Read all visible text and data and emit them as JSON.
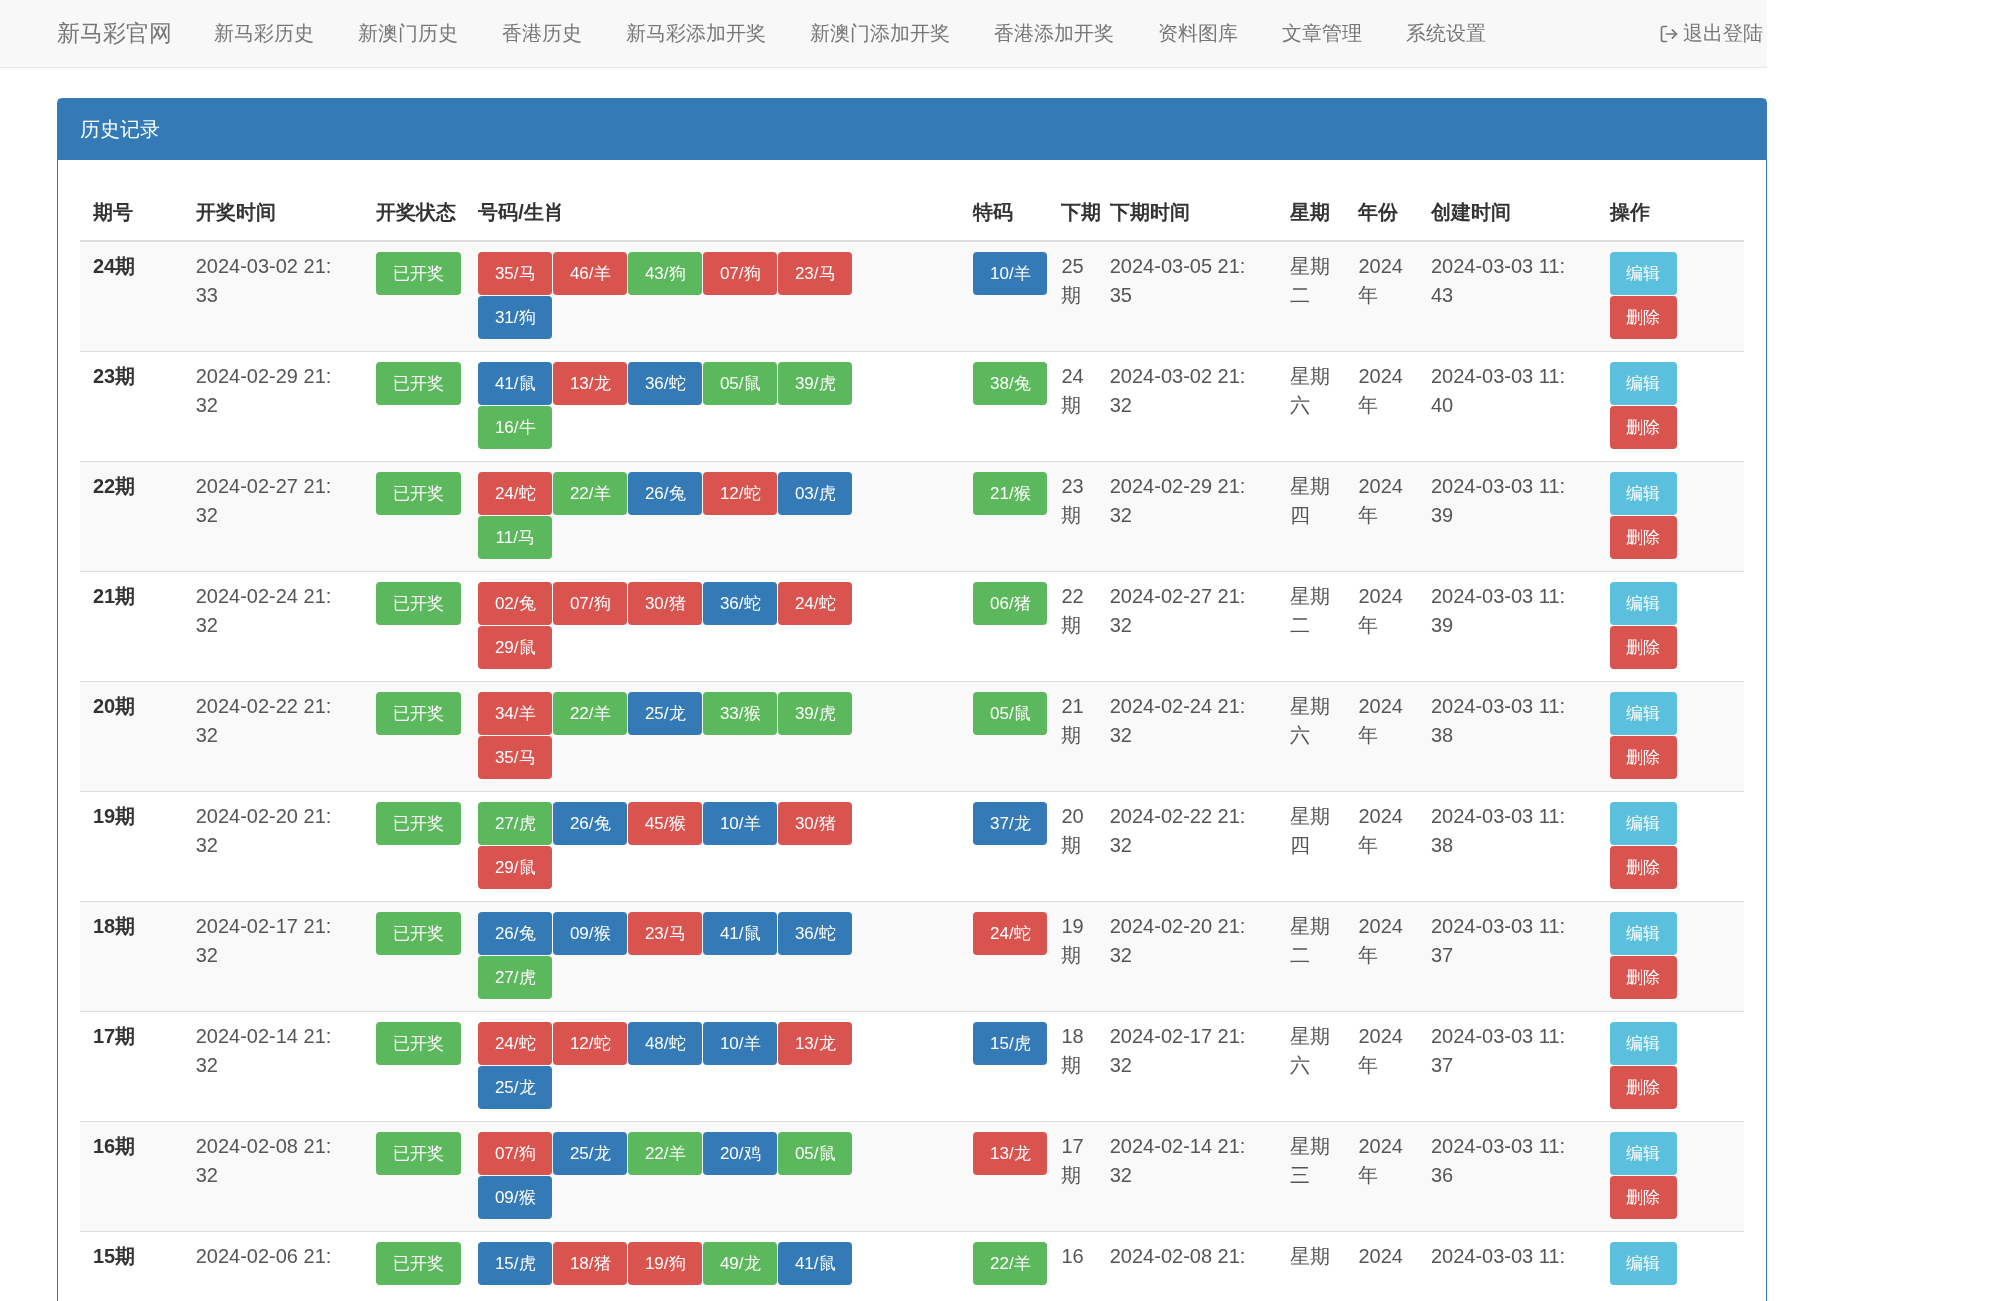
{
  "navbar": {
    "brand": "新马彩官网",
    "items": [
      "新马彩历史",
      "新澳门历史",
      "香港历史",
      "新马彩添加开奖",
      "新澳门添加开奖",
      "香港添加开奖",
      "资料图库",
      "文章管理",
      "系统设置"
    ],
    "logout": "退出登陆"
  },
  "panel": {
    "title": "历史记录",
    "columns": [
      "期号",
      "开奖时间",
      "开奖状态",
      "号码/生肖",
      "特码",
      "下期",
      "下期时间",
      "星期",
      "年份",
      "创建时间",
      "操作"
    ],
    "rows": [
      {
        "period": "24期",
        "draw_time": "2024-03-02 21:33",
        "status": "已开奖",
        "numbers": [
          {
            "text": "35/马",
            "color": "#d9534f"
          },
          {
            "text": "46/羊",
            "color": "#d9534f"
          },
          {
            "text": "43/狗",
            "color": "#5cb85c"
          },
          {
            "text": "07/狗",
            "color": "#d9534f"
          },
          {
            "text": "23/马",
            "color": "#d9534f"
          },
          {
            "text": "31/狗",
            "color": "#337ab7"
          }
        ],
        "special": {
          "text": "10/羊",
          "color": "#337ab7"
        },
        "next_period": "25期",
        "next_time": "2024-03-05 21:35",
        "weekday": "星期二",
        "year": "2024年",
        "created": "2024-03-03 11:43",
        "actions": [
          {
            "kind": "edit",
            "label": "编辑"
          },
          {
            "kind": "delete",
            "label": "删除"
          }
        ]
      },
      {
        "period": "23期",
        "draw_time": "2024-02-29 21:32",
        "status": "已开奖",
        "numbers": [
          {
            "text": "41/鼠",
            "color": "#337ab7"
          },
          {
            "text": "13/龙",
            "color": "#d9534f"
          },
          {
            "text": "36/蛇",
            "color": "#337ab7"
          },
          {
            "text": "05/鼠",
            "color": "#5cb85c"
          },
          {
            "text": "39/虎",
            "color": "#5cb85c"
          },
          {
            "text": "16/牛",
            "color": "#5cb85c"
          }
        ],
        "special": {
          "text": "38/兔",
          "color": "#5cb85c"
        },
        "next_period": "24期",
        "next_time": "2024-03-02 21:32",
        "weekday": "星期六",
        "year": "2024年",
        "created": "2024-03-03 11:40",
        "actions": [
          {
            "kind": "edit",
            "label": "编辑"
          },
          {
            "kind": "delete",
            "label": "删除"
          }
        ]
      },
      {
        "period": "22期",
        "draw_time": "2024-02-27 21:32",
        "status": "已开奖",
        "numbers": [
          {
            "text": "24/蛇",
            "color": "#d9534f"
          },
          {
            "text": "22/羊",
            "color": "#5cb85c"
          },
          {
            "text": "26/兔",
            "color": "#337ab7"
          },
          {
            "text": "12/蛇",
            "color": "#d9534f"
          },
          {
            "text": "03/虎",
            "color": "#337ab7"
          },
          {
            "text": "11/马",
            "color": "#5cb85c"
          }
        ],
        "special": {
          "text": "21/猴",
          "color": "#5cb85c"
        },
        "next_period": "23期",
        "next_time": "2024-02-29 21:32",
        "weekday": "星期四",
        "year": "2024年",
        "created": "2024-03-03 11:39",
        "actions": [
          {
            "kind": "edit",
            "label": "编辑"
          },
          {
            "kind": "delete",
            "label": "删除"
          }
        ]
      },
      {
        "period": "21期",
        "draw_time": "2024-02-24 21:32",
        "status": "已开奖",
        "numbers": [
          {
            "text": "02/兔",
            "color": "#d9534f"
          },
          {
            "text": "07/狗",
            "color": "#d9534f"
          },
          {
            "text": "30/猪",
            "color": "#d9534f"
          },
          {
            "text": "36/蛇",
            "color": "#337ab7"
          },
          {
            "text": "24/蛇",
            "color": "#d9534f"
          },
          {
            "text": "29/鼠",
            "color": "#d9534f"
          }
        ],
        "special": {
          "text": "06/猪",
          "color": "#5cb85c"
        },
        "next_period": "22期",
        "next_time": "2024-02-27 21:32",
        "weekday": "星期二",
        "year": "2024年",
        "created": "2024-03-03 11:39",
        "actions": [
          {
            "kind": "edit",
            "label": "编辑"
          },
          {
            "kind": "delete",
            "label": "删除"
          }
        ]
      },
      {
        "period": "20期",
        "draw_time": "2024-02-22 21:32",
        "status": "已开奖",
        "numbers": [
          {
            "text": "34/羊",
            "color": "#d9534f"
          },
          {
            "text": "22/羊",
            "color": "#5cb85c"
          },
          {
            "text": "25/龙",
            "color": "#337ab7"
          },
          {
            "text": "33/猴",
            "color": "#5cb85c"
          },
          {
            "text": "39/虎",
            "color": "#5cb85c"
          },
          {
            "text": "35/马",
            "color": "#d9534f"
          }
        ],
        "special": {
          "text": "05/鼠",
          "color": "#5cb85c"
        },
        "next_period": "21期",
        "next_time": "2024-02-24 21:32",
        "weekday": "星期六",
        "year": "2024年",
        "created": "2024-03-03 11:38",
        "actions": [
          {
            "kind": "edit",
            "label": "编辑"
          },
          {
            "kind": "delete",
            "label": "删除"
          }
        ]
      },
      {
        "period": "19期",
        "draw_time": "2024-02-20 21:32",
        "status": "已开奖",
        "numbers": [
          {
            "text": "27/虎",
            "color": "#5cb85c"
          },
          {
            "text": "26/兔",
            "color": "#337ab7"
          },
          {
            "text": "45/猴",
            "color": "#d9534f"
          },
          {
            "text": "10/羊",
            "color": "#337ab7"
          },
          {
            "text": "30/猪",
            "color": "#d9534f"
          },
          {
            "text": "29/鼠",
            "color": "#d9534f"
          }
        ],
        "special": {
          "text": "37/龙",
          "color": "#337ab7"
        },
        "next_period": "20期",
        "next_time": "2024-02-22 21:32",
        "weekday": "星期四",
        "year": "2024年",
        "created": "2024-03-03 11:38",
        "actions": [
          {
            "kind": "edit",
            "label": "编辑"
          },
          {
            "kind": "delete",
            "label": "删除"
          }
        ]
      },
      {
        "period": "18期",
        "draw_time": "2024-02-17 21:32",
        "status": "已开奖",
        "numbers": [
          {
            "text": "26/兔",
            "color": "#337ab7"
          },
          {
            "text": "09/猴",
            "color": "#337ab7"
          },
          {
            "text": "23/马",
            "color": "#d9534f"
          },
          {
            "text": "41/鼠",
            "color": "#337ab7"
          },
          {
            "text": "36/蛇",
            "color": "#337ab7"
          },
          {
            "text": "27/虎",
            "color": "#5cb85c"
          }
        ],
        "special": {
          "text": "24/蛇",
          "color": "#d9534f"
        },
        "next_period": "19期",
        "next_time": "2024-02-20 21:32",
        "weekday": "星期二",
        "year": "2024年",
        "created": "2024-03-03 11:37",
        "actions": [
          {
            "kind": "edit",
            "label": "编辑"
          },
          {
            "kind": "delete",
            "label": "删除"
          }
        ]
      },
      {
        "period": "17期",
        "draw_time": "2024-02-14 21:32",
        "status": "已开奖",
        "numbers": [
          {
            "text": "24/蛇",
            "color": "#d9534f"
          },
          {
            "text": "12/蛇",
            "color": "#d9534f"
          },
          {
            "text": "48/蛇",
            "color": "#337ab7"
          },
          {
            "text": "10/羊",
            "color": "#337ab7"
          },
          {
            "text": "13/龙",
            "color": "#d9534f"
          },
          {
            "text": "25/龙",
            "color": "#337ab7"
          }
        ],
        "special": {
          "text": "15/虎",
          "color": "#337ab7"
        },
        "next_period": "18期",
        "next_time": "2024-02-17 21:32",
        "weekday": "星期六",
        "year": "2024年",
        "created": "2024-03-03 11:37",
        "actions": [
          {
            "kind": "edit",
            "label": "编辑"
          },
          {
            "kind": "delete",
            "label": "删除"
          }
        ]
      },
      {
        "period": "16期",
        "draw_time": "2024-02-08 21:32",
        "status": "已开奖",
        "numbers": [
          {
            "text": "07/狗",
            "color": "#d9534f"
          },
          {
            "text": "25/龙",
            "color": "#337ab7"
          },
          {
            "text": "22/羊",
            "color": "#5cb85c"
          },
          {
            "text": "20/鸡",
            "color": "#337ab7"
          },
          {
            "text": "05/鼠",
            "color": "#5cb85c"
          },
          {
            "text": "09/猴",
            "color": "#337ab7"
          }
        ],
        "special": {
          "text": "13/龙",
          "color": "#d9534f"
        },
        "next_period": "17期",
        "next_time": "2024-02-14 21:32",
        "weekday": "星期三",
        "year": "2024年",
        "created": "2024-03-03 11:36",
        "actions": [
          {
            "kind": "edit",
            "label": "编辑"
          },
          {
            "kind": "delete",
            "label": "删除"
          }
        ]
      },
      {
        "period": "15期",
        "draw_time": "2024-02-06 21:",
        "status": "已开奖",
        "numbers": [
          {
            "text": "15/虎",
            "color": "#337ab7"
          },
          {
            "text": "18/猪",
            "color": "#d9534f"
          },
          {
            "text": "19/狗",
            "color": "#d9534f"
          },
          {
            "text": "49/龙",
            "color": "#5cb85c"
          },
          {
            "text": "41/鼠",
            "color": "#337ab7"
          }
        ],
        "special": {
          "text": "22/羊",
          "color": "#5cb85c"
        },
        "next_period": "16",
        "next_time": "2024-02-08 21:",
        "weekday": "星期",
        "year": "2024",
        "created": "2024-03-03 11:",
        "actions": [
          {
            "kind": "edit",
            "label": "编辑"
          }
        ]
      }
    ]
  }
}
